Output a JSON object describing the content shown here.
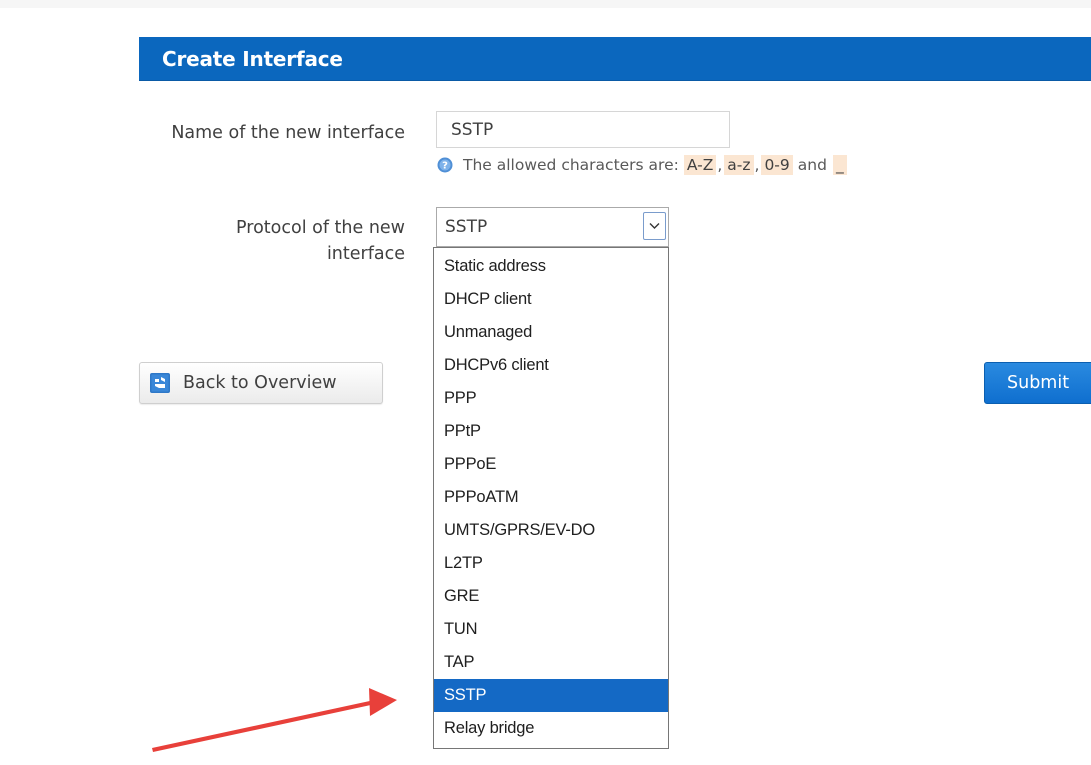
{
  "header": {
    "title": "Create Interface"
  },
  "form": {
    "name_label": "Name of the new interface",
    "name_value": "SSTP",
    "hint": {
      "text": "The allowed characters are:",
      "chars": [
        "A-Z",
        "a-z",
        "0-9",
        "_"
      ],
      "separator": ",",
      "and": "and"
    },
    "protocol_label": "Protocol of the new interface",
    "protocol_value": "SSTP",
    "protocol_options": [
      "Static address",
      "DHCP client",
      "Unmanaged",
      "DHCPv6 client",
      "PPP",
      "PPtP",
      "PPPoE",
      "PPPoATM",
      "UMTS/GPRS/EV-DO",
      "L2TP",
      "GRE",
      "TUN",
      "TAP",
      "SSTP",
      "Relay bridge"
    ],
    "selected_option": "SSTP"
  },
  "buttons": {
    "back_label": "Back to Overview",
    "submit_label": "Submit"
  },
  "colors": {
    "header_bg": "#0b67be",
    "selected_bg": "#1469c5",
    "chip_bg": "#fbe6d2",
    "submit_bg": "#1a7ad6",
    "annotation_arrow": "#e8403a"
  },
  "icons": {
    "help": "help-circle-icon",
    "back": "back-app-icon",
    "select_arrow": "chevron-down-icon",
    "annotation": "red-arrow"
  }
}
